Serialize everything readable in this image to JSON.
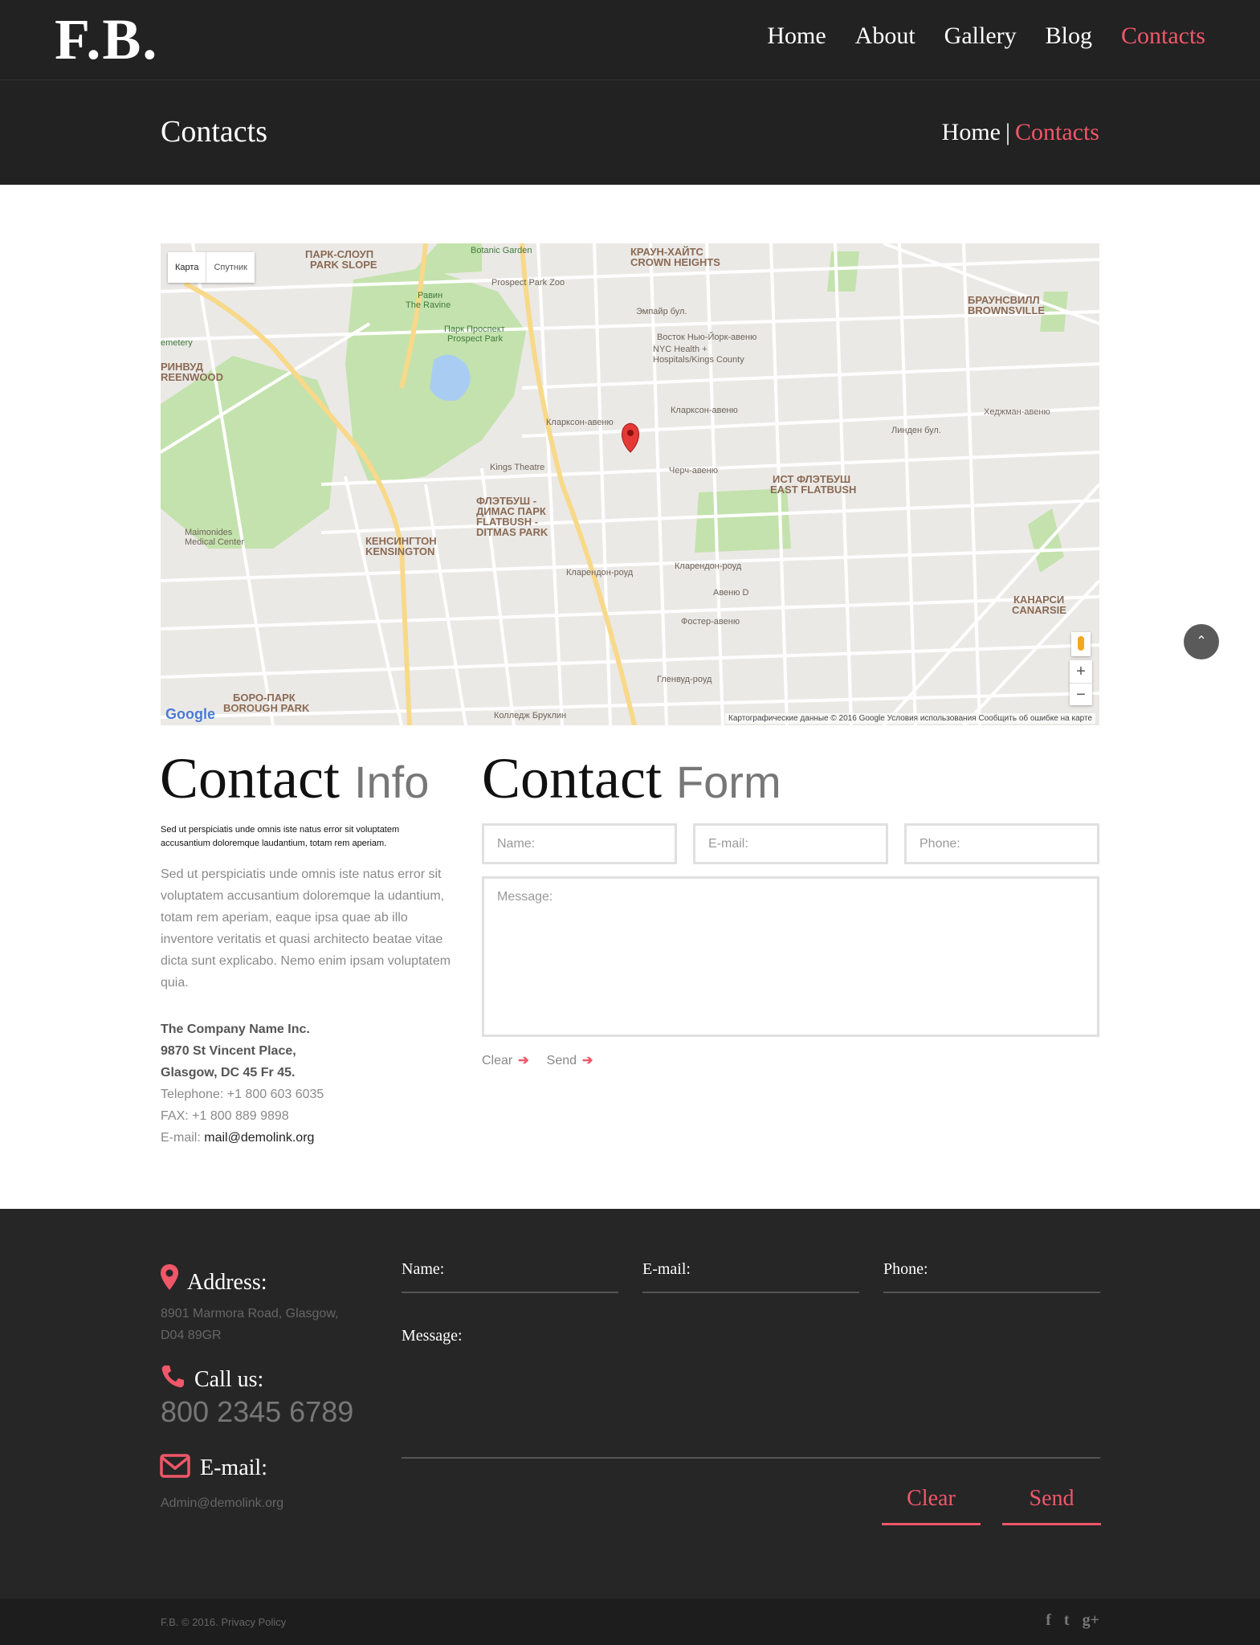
{
  "header": {
    "logo": "F.B.",
    "nav": [
      "Home",
      "About",
      "Gallery",
      "Blog",
      "Contacts"
    ],
    "active_nav": "Contacts"
  },
  "titlebar": {
    "title": "Contacts",
    "breadcrumb_home": "Home",
    "breadcrumb_sep": "|",
    "breadcrumb_current": "Contacts"
  },
  "map": {
    "type_map": "Карта",
    "type_satellite": "Спутник",
    "zoom_in": "+",
    "zoom_out": "−",
    "google": "Google",
    "attribution": "Картографические данные © 2016 Google    Условия использования    Сообщить об ошибке на карте",
    "labels": {
      "park_slope": "ПАРК-СЛОУП",
      "park_slope_en": "PARK SLOPE",
      "crown_heights": "КРАУН-ХАЙТС",
      "crown_heights_en": "CROWN HEIGHTS",
      "botanic": "Botanic Garden",
      "zoo": "Prospect Park Zoo",
      "ravine": "Равин",
      "ravine_en": "The Ravine",
      "prospect_park": "Парк Проспект",
      "prospect_park_en": "Prospect Park",
      "nyc_health": "NYC Health +",
      "kings_county": "Hospitals/Kings County",
      "brownsville": "БРАУНСВИЛЛ",
      "brownsville_en": "BROWNSVILLE",
      "greenwood": "РИНВУД",
      "greenwood_en": "REENWOOD",
      "kings_theatre": "Kings Theatre",
      "flatbush": "ФЛЭТБУШ -",
      "flatbush2": "ДИМАС ПАРК",
      "flatbush_en": "FLATBUSH -",
      "flatbush_en2": "DITMAS PARK",
      "east_flatbush": "ИСТ ФЛЭТБУШ",
      "east_flatbush_en": "EAST FLATBUSH",
      "kensington": "КЕНСИНГТОН",
      "kensington_en": "KENSINGTON",
      "maimonides": "Maimonides",
      "maimonides2": "Medical Center",
      "borough_park": "БОРО-ПАРК",
      "borough_park_en": "BOROUGH PARK",
      "canarsie": "КАНАРСИ",
      "canarsie_en": "CANARSIE",
      "brooklyn_college": "Колледж Бруклин",
      "cemetery": "emetery",
      "clarkson": "Кларксон-авеню",
      "church": "Черч-авеню",
      "clarendon": "Кларендон-роуд",
      "avenue_d": "Авеню D",
      "foster": "Фостер-авеню",
      "glenwood": "Гленвуд-роуд",
      "empire": "Эмпайр бул.",
      "new_york_ave": "Восток Нью-Йорк-авеню",
      "linden": "Линден бул.",
      "hegeman": "Хеджман-авеню"
    }
  },
  "contact_info": {
    "heading_main": "Contact",
    "heading_light": "Info",
    "intro_bold": "Sed ut perspiciatis unde omnis iste natus error sit voluptatem accusantium doloremque laudantium, totam rem aperiam.",
    "intro_text": "Sed ut perspiciatis unde omnis iste natus error sit voluptatem accusantium doloremque la udantium, totam rem aperiam, eaque ipsa quae ab illo inventore veritatis et quasi architecto beatae vitae dicta sunt explicabo. Nemo enim ipsam voluptatem quia.",
    "company": "The Company Name Inc.",
    "street": "9870 St Vincent Place,",
    "city": "Glasgow, DC 45 Fr 45.",
    "telephone": "Telephone: +1 800 603 6035",
    "fax": "FAX: +1 800 889 9898",
    "email_label": "E-mail: ",
    "email": "mail@demolink.org"
  },
  "contact_form": {
    "heading_main": "Contact",
    "heading_light": "Form",
    "name_placeholder": "Name:",
    "email_placeholder": "E-mail:",
    "phone_placeholder": "Phone:",
    "message_placeholder": "Message:",
    "clear": "Clear",
    "send": "Send",
    "arrow": "➔"
  },
  "scroll_top": "⌃",
  "footer": {
    "address_label": "Address:",
    "address_text": "8901 Marmora Road, Glasgow, D04 89GR",
    "call_label": "Call us:",
    "phone": "800 2345 6789",
    "email_label": "E-mail:",
    "email": "Admin@demolink.org",
    "name_label": "Name:",
    "email_field_label": "E-mail:",
    "phone_label": "Phone:",
    "message_label": "Message:",
    "clear": "Clear",
    "send": "Send",
    "copyright": "F.B. © 2016. Privacy Policy",
    "social": [
      "f",
      "t",
      "g+"
    ]
  },
  "colors": {
    "accent": "#f05769",
    "dark": "#222222",
    "footer": "#262626"
  }
}
